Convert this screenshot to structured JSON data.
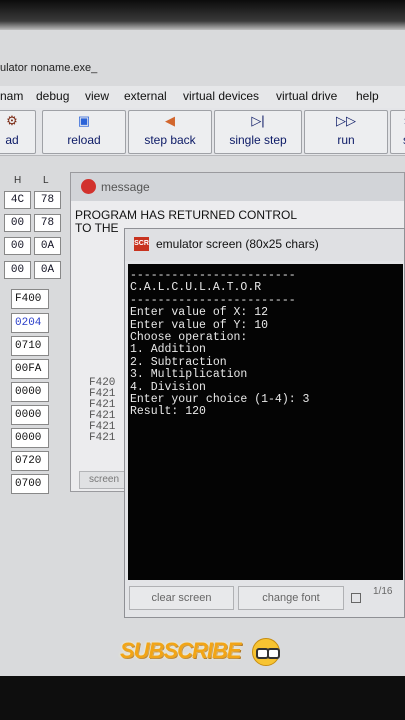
{
  "app": {
    "title": "ulator noname.exe_"
  },
  "menu": [
    "nam",
    "debug",
    "view",
    "external",
    "virtual devices",
    "virtual drive",
    "help"
  ],
  "toolbar": {
    "load": "ad",
    "reload": "reload",
    "step_back": "step back",
    "single_step": "single step",
    "run": "run",
    "step": "s"
  },
  "registers": {
    "header_h": "H",
    "header_l": "L",
    "rows": [
      {
        "h": "4C",
        "l": "78"
      },
      {
        "h": "00",
        "l": "78"
      },
      {
        "h": "00",
        "l": "0A"
      },
      {
        "h": "00",
        "l": "0A"
      }
    ],
    "segments": [
      "F400",
      "0204",
      "0710",
      "00FA",
      "0000",
      "0000",
      "0000",
      "0720",
      "0700"
    ]
  },
  "message_window": {
    "title": "message",
    "text_line1": "PROGRAM HAS RETURNED CONTROL",
    "text_line2": "TO THE",
    "code_lines": [
      "F420",
      "F421",
      "F421",
      "F421",
      "F421",
      "F421"
    ],
    "screen_label": "screen"
  },
  "emulator_screen": {
    "title": "emulator screen (80x25 chars)",
    "icon_text": "SCR",
    "console": "------------------------\nC.A.L.C.U.L.A.T.O.R\n------------------------\nEnter value of X: 12\nEnter value of Y: 10\nChoose operation:\n1. Addition\n2. Subtraction\n3. Multiplication\n4. Division\nEnter your choice (1-4): 3\nResult: 120",
    "clear_button": "clear screen",
    "font_button": "change font",
    "page_indicator": "1/16"
  },
  "overlay": {
    "subscribe": "SUBSCRIBE"
  }
}
